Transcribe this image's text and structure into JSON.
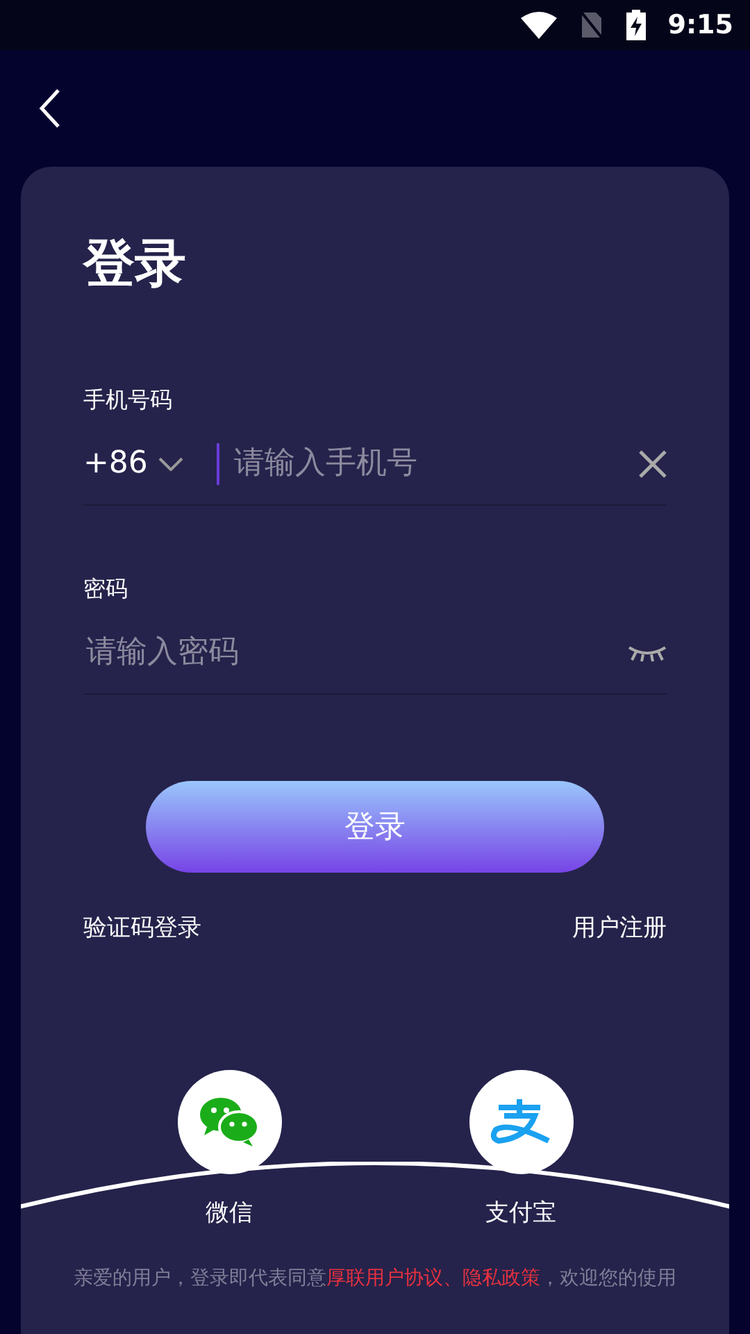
{
  "status_bar": {
    "time": "9:15"
  },
  "title": "登录",
  "phone": {
    "label": "手机号码",
    "country_code": "+86",
    "placeholder": "请输入手机号"
  },
  "password": {
    "label": "密码",
    "placeholder": "请输入密码"
  },
  "login_button": "登录",
  "links": {
    "left": "验证码登录",
    "right": "用户注册"
  },
  "social": [
    {
      "kind": "wechat",
      "label": "微信"
    },
    {
      "kind": "alipay",
      "label": "支付宝"
    }
  ],
  "legal": {
    "before": "亲爱的用户，登录即代表同意",
    "links": [
      "厚联用户协议",
      "隐私政策"
    ],
    "separator": "、",
    "after": "，欢迎您的使用"
  }
}
